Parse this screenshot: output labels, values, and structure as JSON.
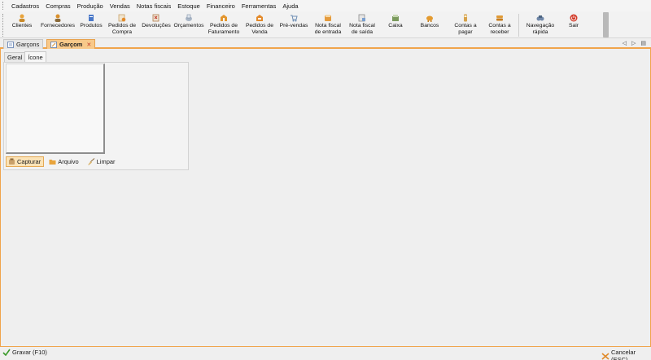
{
  "menu": [
    "Cadastros",
    "Compras",
    "Produção",
    "Vendas",
    "Notas fiscais",
    "Estoque",
    "Financeiro",
    "Ferramentas",
    "Ajuda"
  ],
  "toolbar": [
    {
      "label": "Clientes",
      "icon": "clients-icon",
      "color": "#e8a43c"
    },
    {
      "label": "Fornecedores",
      "icon": "suppliers-icon",
      "color": "#d9902d"
    },
    {
      "label": "Produtos",
      "icon": "products-icon",
      "color": "#4a78c8"
    },
    {
      "label": "Pedidos de\nCompra",
      "icon": "purchase-order-icon",
      "color": "#c9a36a"
    },
    {
      "label": "Devoluções",
      "icon": "returns-icon",
      "color": "#b07a4a"
    },
    {
      "label": "Orçamentos",
      "icon": "quotes-icon",
      "color": "#7f8ea3"
    },
    {
      "label": "Pedidos de\nFaturamento",
      "icon": "billing-order-icon",
      "color": "#e3962e"
    },
    {
      "label": "Pedidos de\nVenda",
      "icon": "sales-order-icon",
      "color": "#e38a2a"
    },
    {
      "label": "Pré-vendas",
      "icon": "cart-icon",
      "color": "#6f8fb5"
    },
    {
      "label": "Nota fiscal\nde entrada",
      "icon": "invoice-in-icon",
      "color": "#e59b3c"
    },
    {
      "label": "Nota fiscal\nde saída",
      "icon": "invoice-out-icon",
      "color": "#8c8c8c"
    },
    {
      "label": "Caixa",
      "icon": "cash-register-icon",
      "color": "#7a9a5c"
    },
    {
      "label": "Bancos",
      "icon": "piggy-bank-icon",
      "color": "#e39a2f"
    },
    {
      "label": "Contas a\npagar",
      "icon": "accounts-payable-icon",
      "color": "#d6a24a"
    },
    {
      "label": "Contas a\nreceber",
      "icon": "accounts-receivable-icon",
      "color": "#e09a36"
    },
    {
      "label": "Navegação\nrápida",
      "icon": "quick-nav-icon",
      "color": "#6f87a8"
    },
    {
      "label": "Sair",
      "icon": "power-icon",
      "color": "#d23b2a"
    }
  ],
  "doc_tabs": [
    {
      "label": "Garçons",
      "icon": "list-icon"
    },
    {
      "label": "Garçom",
      "icon": "edit-icon"
    }
  ],
  "panel_tabs": [
    "Geral",
    "Ícone"
  ],
  "panel_buttons": [
    {
      "label": "Capturar",
      "icon": "capture-icon"
    },
    {
      "label": "Arquivo",
      "icon": "folder-icon"
    },
    {
      "label": "Limpar",
      "icon": "broom-icon"
    }
  ],
  "footer": {
    "save": "Gravar (F10)",
    "cancel": "Cancelar (ESC)"
  },
  "accent_color": "#f0a44b"
}
